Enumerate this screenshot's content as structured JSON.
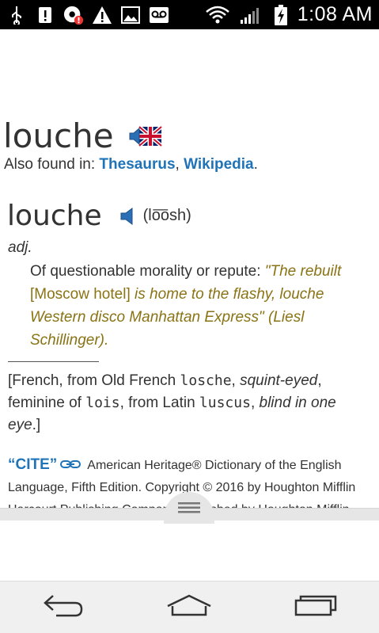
{
  "status_bar": {
    "time": "1:08 AM",
    "icons": [
      "usb-icon",
      "alert-icon",
      "notification-icon",
      "warning-icon",
      "image-icon",
      "voicemail-icon",
      "wifi-icon",
      "signal-icon",
      "battery-charging-icon"
    ]
  },
  "headword": {
    "word": "louche",
    "also_found_label": "Also found in: ",
    "links": [
      "Thesaurus",
      "Wikipedia"
    ],
    "separator": ", ",
    "end_punct": "."
  },
  "entry": {
    "word": "louche",
    "pronunciation": "(lo͞osh)",
    "part_of_speech": "adj.",
    "definition": "Of questionable morality or repute: ",
    "quote_part1": "\"The rebuilt ",
    "quote_bracket": "[Moscow hotel]",
    "quote_part2": " is home to the flashy, louche Western disco Manhattan Express\" (Liesl Schillinger)."
  },
  "etymology": {
    "open": "[French, from Old French ",
    "w1": "losche",
    "g1": "squint-eyed",
    "t2": ", feminine of ",
    "w2": "lois",
    "t3": ", from Latin ",
    "w3": "luscus",
    "t4": ", ",
    "g2": "blind in one eye",
    "close": ".]"
  },
  "cite": {
    "label": "“CITE”",
    "text": "American Heritage® Dictionary of the English Language, Fifth Edition. Copyright © 2016 by Houghton Mifflin Harcourt Publishing Company. Published by Houghton Mifflin"
  },
  "nav": {
    "buttons": [
      "back-button",
      "home-button",
      "recents-button"
    ]
  }
}
